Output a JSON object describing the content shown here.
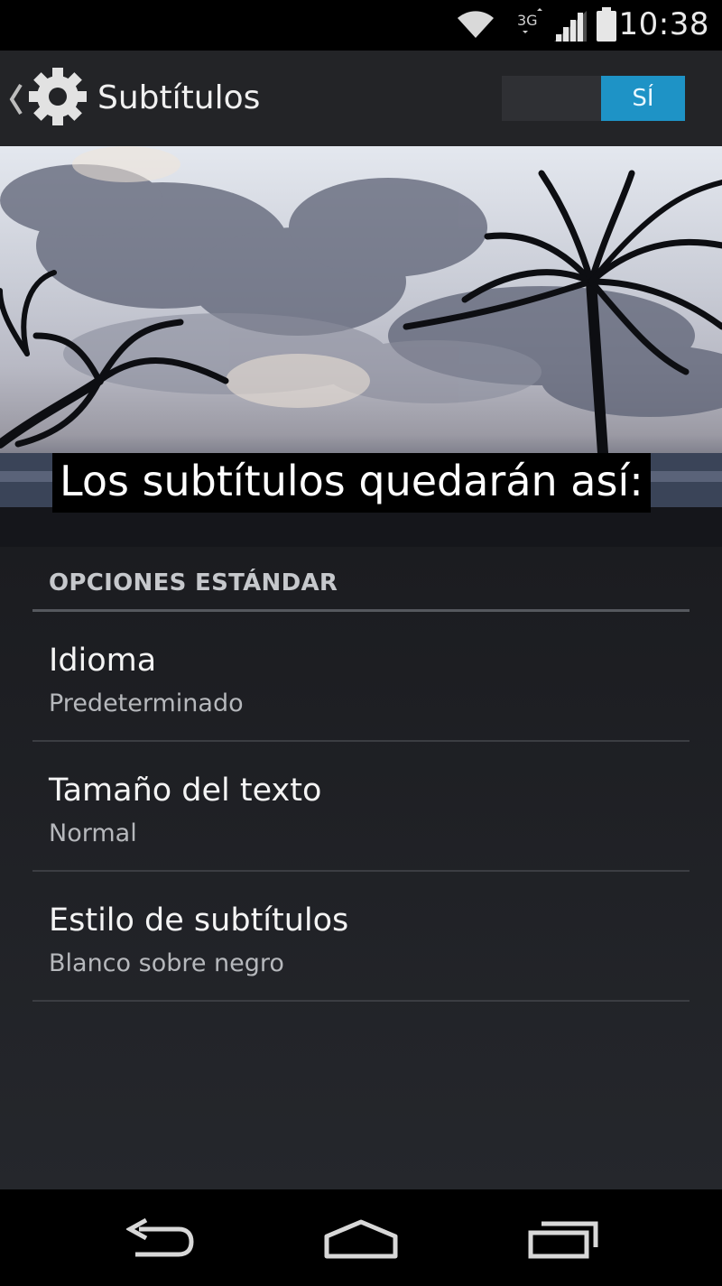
{
  "status_bar": {
    "time": "10:38",
    "icons": [
      "wifi-icon",
      "data-sync-icon",
      "cell-signal-icon",
      "battery-icon"
    ]
  },
  "action_bar": {
    "title": "Subtítulos",
    "icon": "gear-icon",
    "toggle_label": "SÍ",
    "toggle_state": "on",
    "accent_color": "#1e93c6"
  },
  "preview": {
    "caption": "Los subtítulos quedarán así:"
  },
  "settings": {
    "section_header": "OPCIONES ESTÁNDAR",
    "items": [
      {
        "title": "Idioma",
        "summary": "Predeterminado"
      },
      {
        "title": "Tamaño del texto",
        "summary": "Normal"
      },
      {
        "title": "Estilo de subtítulos",
        "summary": "Blanco sobre negro"
      }
    ]
  },
  "nav_bar": {
    "icons": [
      "back-icon",
      "home-icon",
      "recents-icon"
    ]
  }
}
